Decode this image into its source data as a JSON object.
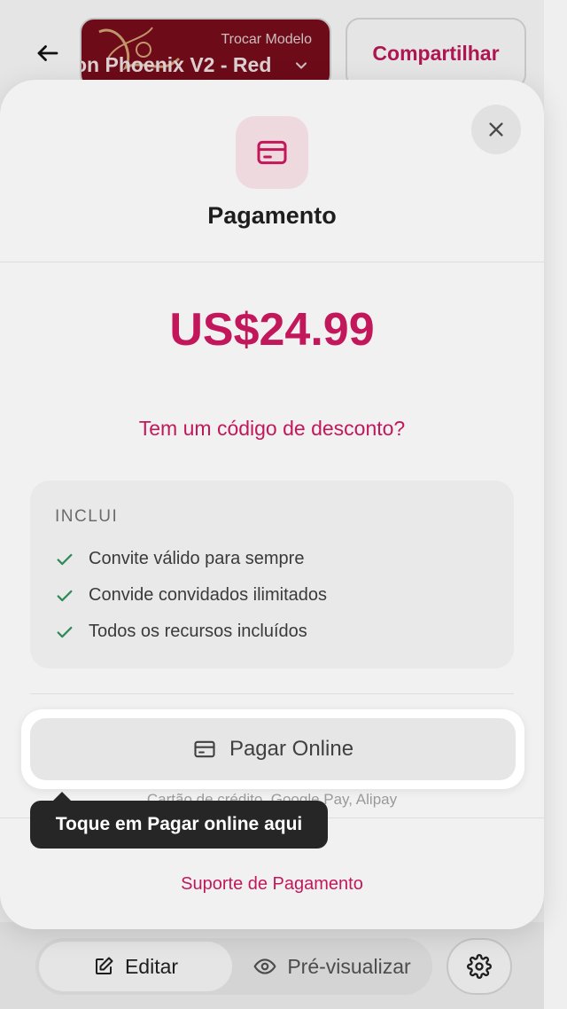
{
  "header": {
    "back_icon": "arrow-left-icon",
    "template": {
      "caption": "Trocar Modelo",
      "name": "on Phoenix V2 - Red",
      "chevron_icon": "chevron-down-icon"
    },
    "share_label": "Compartilhar"
  },
  "modal": {
    "icon": "credit-card-icon",
    "title": "Pagamento",
    "price": "US$24.99",
    "discount_link": "Tem um código de desconto?",
    "includes": {
      "heading": "INCLUI",
      "items": [
        "Convite válido para sempre",
        "Convide convidados ilimitados",
        "Todos os recursos incluídos"
      ]
    },
    "pay_online_label": "Pagar Online",
    "payment_methods": "Cartão de crédito, Google Pay, Alipay",
    "support_link": "Suporte de Pagamento",
    "close_icon": "close-icon"
  },
  "tooltip": {
    "text": "Toque em Pagar online aqui"
  },
  "bottom_bar": {
    "edit_label": "Editar",
    "preview_label": "Pré-visualizar",
    "settings_icon": "gear-icon"
  },
  "colors": {
    "accent": "#c2185b",
    "check": "#2e8b57",
    "template_bg": "#7a0d1c"
  }
}
